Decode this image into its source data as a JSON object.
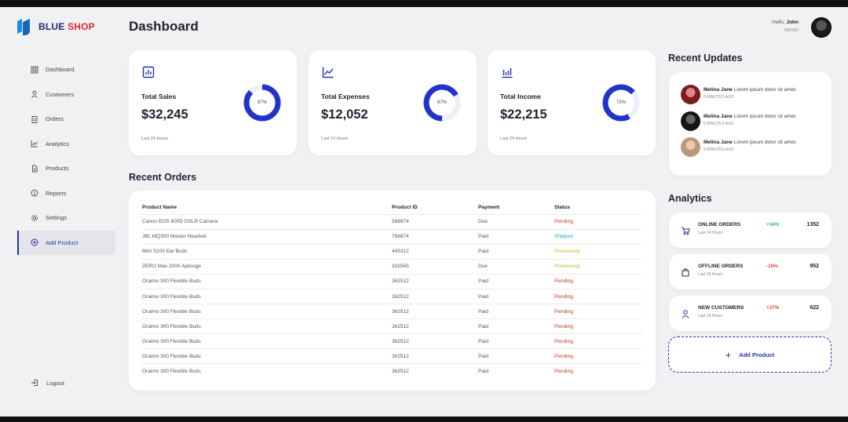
{
  "brand": {
    "name_part1": "BLUE",
    "name_part2": "SHOP"
  },
  "sidebar": {
    "items": [
      {
        "label": "Dashboard",
        "icon": "grid-icon"
      },
      {
        "label": "Customers",
        "icon": "user-icon"
      },
      {
        "label": "Orders",
        "icon": "clipboard-icon"
      },
      {
        "label": "Analytics",
        "icon": "line-chart-icon"
      },
      {
        "label": "Products",
        "icon": "document-icon"
      },
      {
        "label": "Reports",
        "icon": "info-icon"
      },
      {
        "label": "Settings",
        "icon": "gear-icon"
      },
      {
        "label": "Add Product",
        "icon": "plus-circle-icon",
        "active": true
      }
    ],
    "logout": "Logout"
  },
  "header": {
    "title": "Dashboard",
    "greeting": "Hello,",
    "user_name": "John",
    "user_role": "Admin"
  },
  "stats": [
    {
      "label": "Total Sales",
      "value": "$32,245",
      "percent_label": "87%",
      "percent": 87,
      "footer": "Last 24 Hours",
      "icon": "bar-chart-icon"
    },
    {
      "label": "Total Expenses",
      "value": "$12,052",
      "percent_label": "67%",
      "percent": 67,
      "footer": "Last 24 Hours",
      "icon": "line-chart-icon"
    },
    {
      "label": "Total Income",
      "value": "$22,215",
      "percent_label": "72%",
      "percent": 72,
      "footer": "Last 24 Hours",
      "icon": "bar-chart-icon"
    }
  ],
  "orders": {
    "title": "Recent Orders",
    "columns": [
      "Product Name",
      "Product ID",
      "Payment",
      "Status"
    ],
    "rows": [
      [
        "Canon EOS 600D DSLR Camera",
        "568974",
        "Due",
        "Pending"
      ],
      [
        "JBL MQ300 Master Headset",
        "768874",
        "Paid",
        "Shipped"
      ],
      [
        "Mini S100 Ear Buds",
        "445312",
        "Paid",
        "Processing"
      ],
      [
        "ZERO Max 2000 Apliouge",
        "332565",
        "Due",
        "Processing"
      ],
      [
        "Oraimo 300 Flexible Buds",
        "362512",
        "Paid",
        "Pending"
      ],
      [
        "Oraimo 300 Flexible Buds",
        "362512",
        "Paid",
        "Pending"
      ],
      [
        "Oraimo 300 Flexible Buds",
        "362512",
        "Paid",
        "Pending"
      ],
      [
        "Oraimo 300 Flexible Buds",
        "362512",
        "Paid",
        "Pending"
      ],
      [
        "Oraimo 300 Flexible Buds",
        "362512",
        "Paid",
        "Pending"
      ],
      [
        "Oraimo 300 Flexible Buds",
        "362512",
        "Paid",
        "Pending"
      ],
      [
        "Oraimo 300 Flexible Buds",
        "362512",
        "Paid",
        "Pending"
      ]
    ]
  },
  "updates": {
    "title": "Recent Updates",
    "items": [
      {
        "name": "Melina Jane",
        "text": "Lorem ipsum dolor sit amet.",
        "time": "5 MINUTES AGO"
      },
      {
        "name": "Melina Jane",
        "text": "Lorem ipsum dolor sit amet.",
        "time": "5 MINUTES AGO"
      },
      {
        "name": "Melina Jane",
        "text": "Lorem ipsum dolor sit amet.",
        "time": "5 MINUTES AGO"
      }
    ]
  },
  "analytics": {
    "title": "Analytics",
    "items": [
      {
        "name": "ONLINE ORDERS",
        "sub": "Last 24 Hours",
        "pct": "+34%",
        "num": "1352",
        "icon": "cart-icon"
      },
      {
        "name": "OFFLINE ORDERS",
        "sub": "Last 24 Hours",
        "pct": "-16%",
        "num": "952",
        "icon": "bag-icon"
      },
      {
        "name": "NEW CUSTOMERS",
        "sub": "Last 24 Hours",
        "pct": "+37%",
        "num": "622",
        "icon": "user-icon"
      }
    ],
    "add_label": "Add Product"
  },
  "colors": {
    "accent": "#2233aa",
    "pending": "#c0392b",
    "shipped": "#26a6b6",
    "processing": "#c8b02a",
    "positive": "#2bb39b",
    "negative": "#d34a3a"
  }
}
